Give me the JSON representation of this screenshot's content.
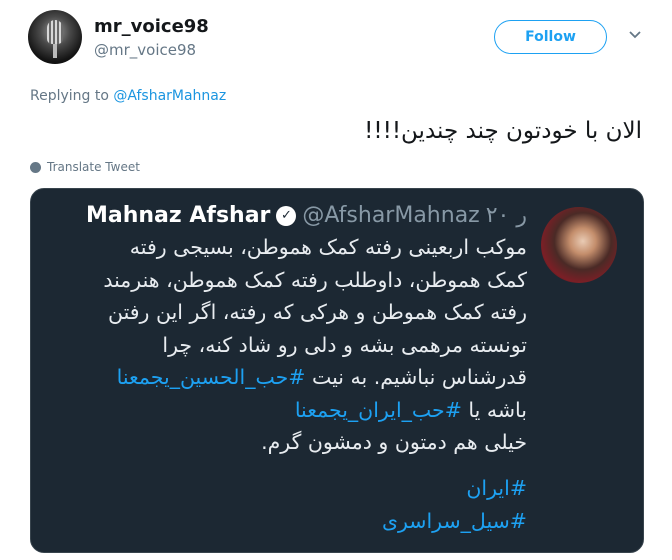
{
  "author": {
    "name": "mr_voice98",
    "handle": "@mr_voice98",
    "follow_label": "Follow"
  },
  "replying": {
    "prefix": "Replying to",
    "handle": "@AfsharMahnaz"
  },
  "tweet": {
    "text": "الان با خودتون چند چندین!!!!",
    "translate_label": "Translate Tweet"
  },
  "quote": {
    "name": "Mahnaz Afshar",
    "handle": "@AfsharMahnaz",
    "time": "۲۰ ر",
    "lines": [
      "موکب اربعینی رفته کمک هموطن، بسیجی رفته",
      "کمک هموطن، داوطلب رفته کمک هموطن، هنرمند",
      "رفته کمک هموطن و هرکی که رفته، اگر این رفتن",
      "تونسته مرهمی بشه و دلی رو شاد کنه، چرا",
      "قدرشناس نباشیم. به نیت",
      "باشه یا",
      "خیلی هم دمتون و دمشون گرم."
    ],
    "hashtag_1": "#حب_الحسین_یجمعنا",
    "hashtag_2": "#حب_ایران_یجمعنا",
    "hashtag_3": "#ایران",
    "hashtag_4": "#سیل_سراسری"
  },
  "colors": {
    "accent": "#1da1f2",
    "quote_background": "#1c2833",
    "muted_text": "#657786"
  }
}
